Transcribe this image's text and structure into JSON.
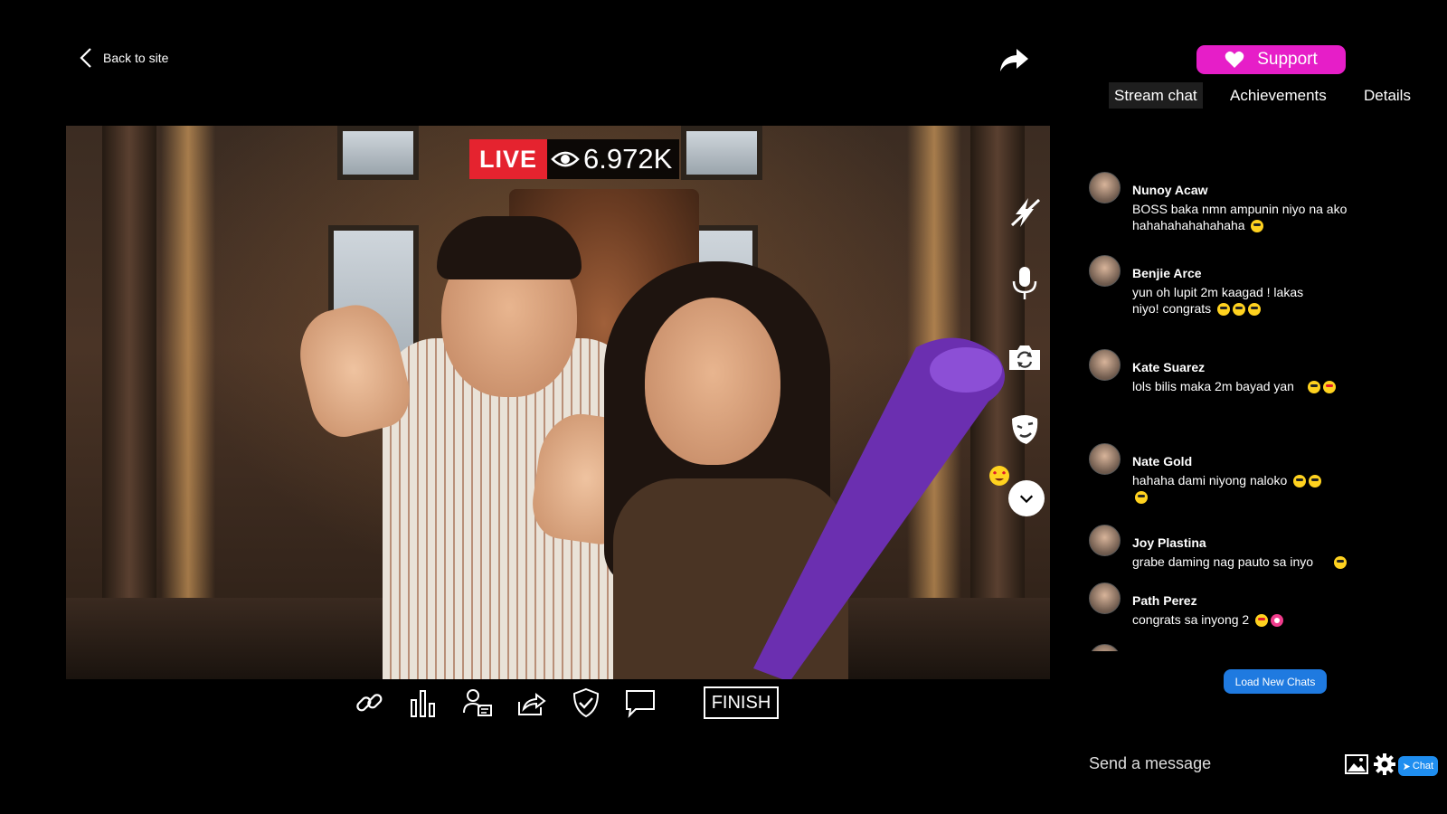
{
  "header": {
    "back_label": "Back to site"
  },
  "stream": {
    "live_label": "LIVE",
    "viewer_count": "6.972K"
  },
  "toolbar": {
    "finish_label": "FINISH"
  },
  "side": {
    "support_label": "Support",
    "tabs": [
      {
        "label": "Stream chat",
        "active": true
      },
      {
        "label": "Achievements",
        "active": false
      },
      {
        "label": "Details",
        "active": false
      }
    ]
  },
  "chat": {
    "messages": [
      {
        "name": "Nunoy Acaw",
        "text": "BOSS baka nmn ampunin niyo na ako hahahahahahahaha",
        "emojis": [
          "grin"
        ]
      },
      {
        "name": "Benjie Arce",
        "text": "yun oh lupit 2m kaagad ! lakas niyo! congrats",
        "emojis": [
          "grin",
          "grin",
          "grin"
        ]
      },
      {
        "name": "Kate Suarez",
        "text": "lols bilis maka 2m bayad yan",
        "emojis": [
          "grin",
          "love"
        ]
      },
      {
        "name": "Nate Gold",
        "text": "hahaha dami niyong naloko",
        "emojis": [
          "grin",
          "grin",
          "grin"
        ]
      },
      {
        "name": "Joy Plastina",
        "text": "grabe daming nag pauto sa inyo",
        "emojis": [
          "grin"
        ]
      },
      {
        "name": "Path Perez",
        "text": "congrats sa inyong 2",
        "emojis": [
          "love",
          "heart"
        ]
      }
    ],
    "load_new_label": "Load New Chats",
    "input_placeholder": "Send a message",
    "chat_button_label": "Chat"
  },
  "colors": {
    "live_red": "#e5232f",
    "support_magenta": "#e61ec8",
    "button_blue": "#1f7ae0"
  },
  "icons": {
    "video_tools": [
      "flash-off-icon",
      "microphone-icon",
      "camera-switch-icon",
      "mask-icon"
    ],
    "bottom_toolbar": [
      "link-icon",
      "stats-icon",
      "guest-icon",
      "share-icon",
      "shield-check-icon",
      "comment-icon"
    ]
  }
}
